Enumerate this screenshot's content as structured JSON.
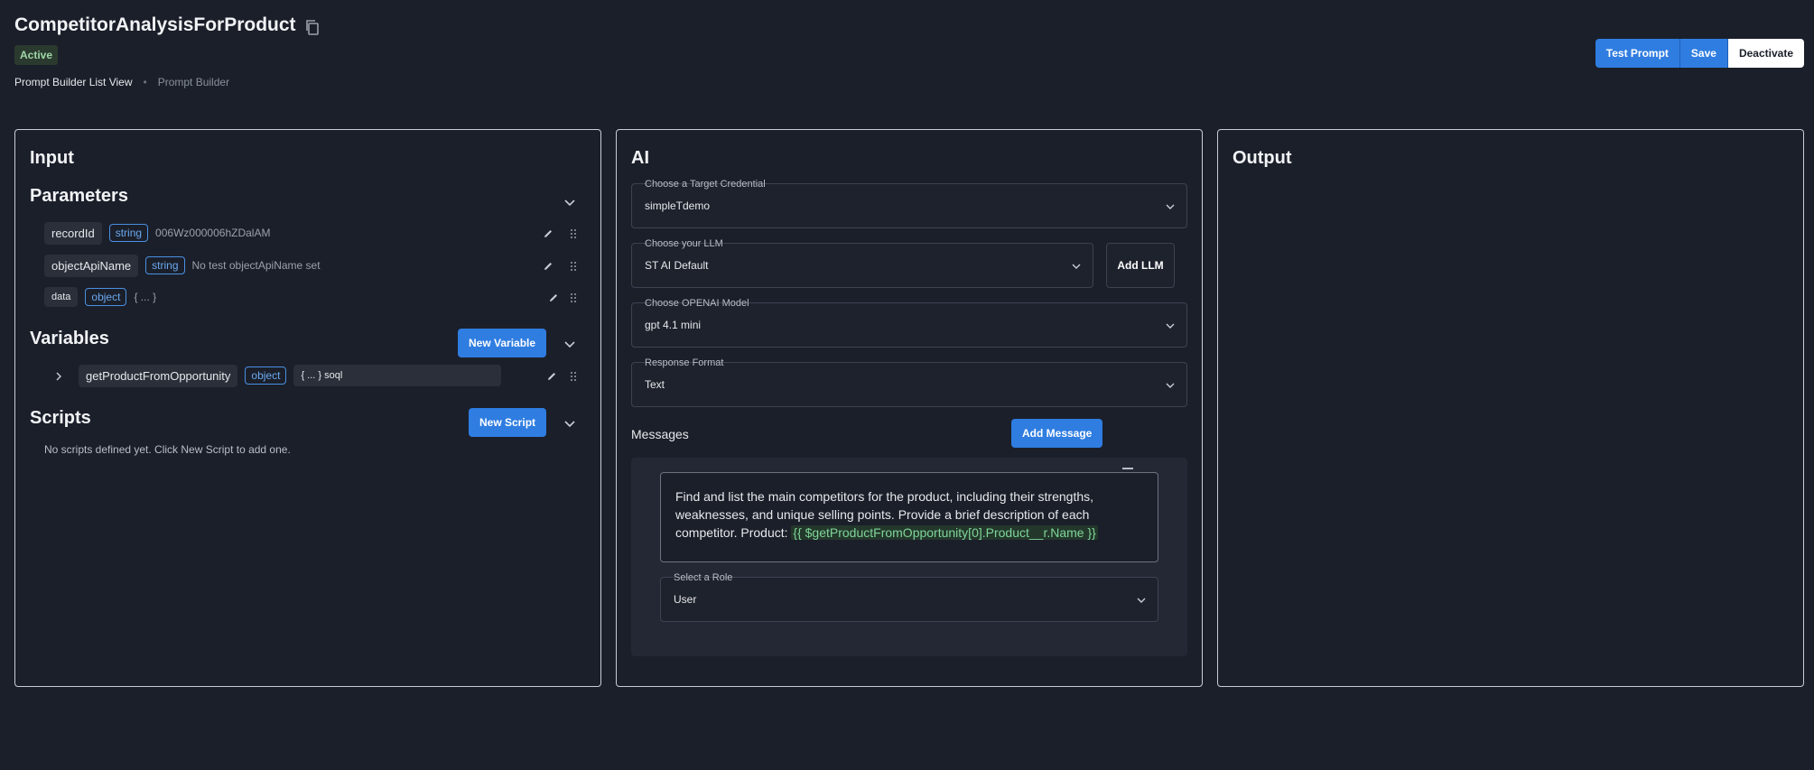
{
  "app": {
    "title": "CompetitorAnalysisForProduct",
    "status": "Active"
  },
  "breadcrumb": {
    "link": "Prompt Builder List View",
    "current": "Prompt Builder"
  },
  "toolbar": {
    "test_label": "Test Prompt",
    "save_label": "Save",
    "deactivate_label": "Deactivate"
  },
  "input": {
    "title": "Input",
    "parameters_title": "Parameters",
    "parameters": [
      {
        "name": "recordId",
        "type": "string",
        "value": "006Wz000006hZDalAM"
      },
      {
        "name": "objectApiName",
        "type": "string",
        "value": "No test objectApiName set"
      },
      {
        "name": "data",
        "type": "object",
        "value": "{ ... }"
      }
    ],
    "variables_title": "Variables",
    "new_variable_label": "New Variable",
    "variables": [
      {
        "name": "getProductFromOpportunity",
        "type": "object",
        "value": "{ ... } soql"
      }
    ],
    "scripts_title": "Scripts",
    "new_script_label": "New Script",
    "scripts_empty": "No scripts defined yet. Click New Script to add one."
  },
  "ai": {
    "title": "AI",
    "credential": {
      "label": "Choose a Target Credential",
      "value": "simpleTdemo"
    },
    "llm": {
      "label": "Choose your LLM",
      "value": "ST AI Default"
    },
    "add_llm_label": "Add LLM",
    "model": {
      "label": "Choose OPENAI Model",
      "value": "gpt 4.1 mini"
    },
    "response_format": {
      "label": "Response Format",
      "value": "Text"
    },
    "messages_label": "Messages",
    "add_message_label": "Add Message",
    "message": {
      "text": "Find and list the main competitors for the product, including their strengths, weaknesses, and unique selling points. Provide a brief description of each competitor. Product: ",
      "token": "{{ $getProductFromOpportunity[0].Product__r.Name }}"
    },
    "role": {
      "label": "Select a Role",
      "value": "User"
    }
  },
  "output": {
    "title": "Output"
  },
  "colors": {
    "background": "#1b1f2a",
    "accent": "#2f7de1",
    "status_bg": "#2b3a2e",
    "status_text": "#9fd8a8",
    "token_text": "#7fd49a"
  }
}
